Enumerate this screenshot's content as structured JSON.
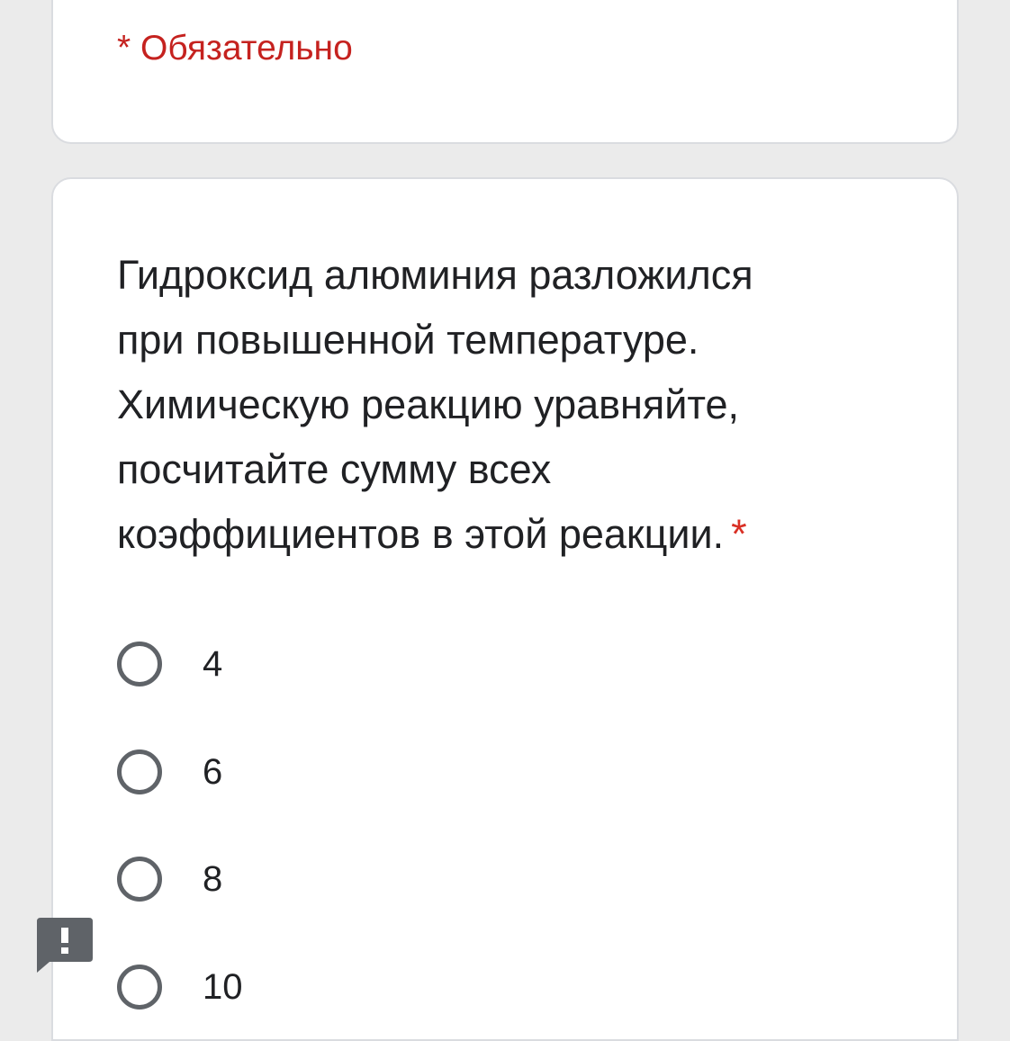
{
  "header": {
    "required_note": "* Обязательно"
  },
  "question": {
    "lines": [
      "Гидроксид алюминия разложился",
      "при повышенной температуре.",
      "Химическую реакцию уравняйте,",
      "посчитайте сумму всех",
      "коэффициентов в этой реакции."
    ],
    "required_marker": "*",
    "options": [
      "4",
      "6",
      "8",
      "10"
    ]
  },
  "report_button": {
    "icon": "exclamation-report-icon"
  },
  "colors": {
    "background": "#ebebeb",
    "card": "#ffffff",
    "required": "#d93025",
    "text": "#202124",
    "radio_border": "#5f6368",
    "report_button": "#5f6368"
  }
}
